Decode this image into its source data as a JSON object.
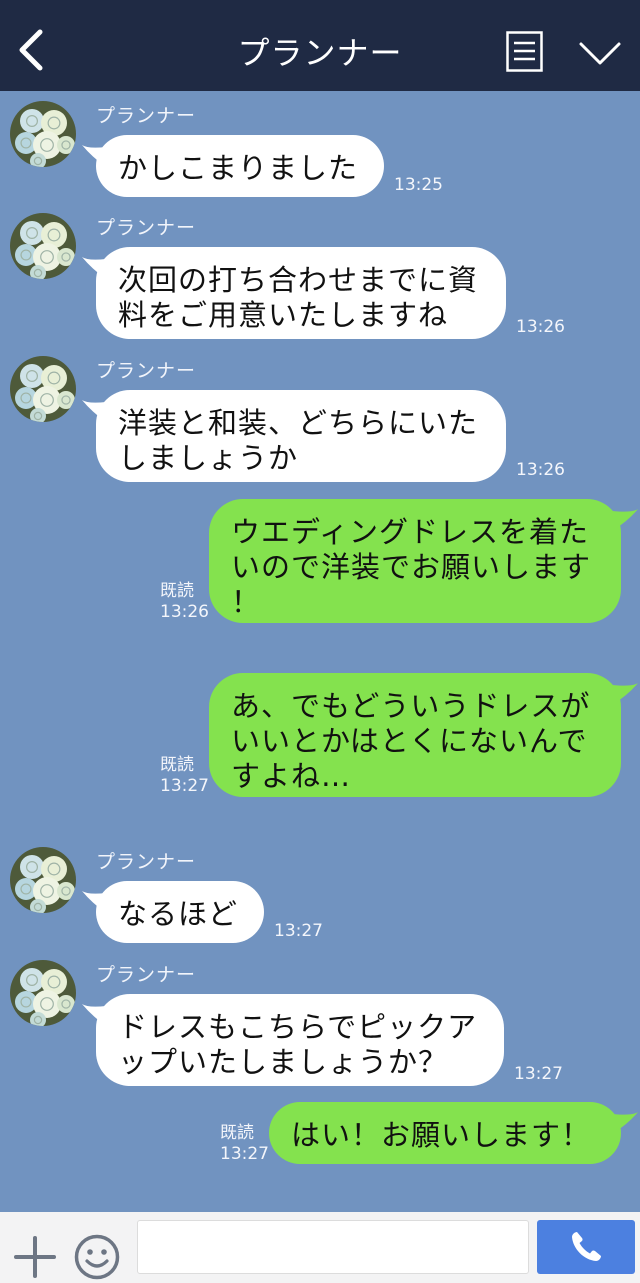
{
  "header": {
    "title": "プランナー",
    "back_icon": "chevron-left-icon",
    "menu_icon": "list-icon",
    "collapse_icon": "chevron-down-icon",
    "background": "#1f2a44"
  },
  "theme": {
    "chat_background": "#7193c0",
    "incoming_bubble": "#ffffff",
    "outgoing_bubble": "#84e24e",
    "send_button": "#4c80e0"
  },
  "messages": [
    {
      "direction": "in",
      "sender": "プランナー",
      "lines": [
        "かしこまりました"
      ],
      "time": "13:25"
    },
    {
      "direction": "in",
      "sender": "プランナー",
      "lines": [
        "次回の打ち合わせまでに資",
        "料をご用意いたしますね"
      ],
      "time": "13:26"
    },
    {
      "direction": "in",
      "sender": "プランナー",
      "lines": [
        "洋装と和装、どちらにいた",
        "しましょうか"
      ],
      "time": "13:26"
    },
    {
      "direction": "out",
      "lines": [
        "ウエディングドレスを着た",
        "いので洋装でお願いします",
        "！"
      ],
      "read": "既読",
      "time": "13:26"
    },
    {
      "direction": "out",
      "lines": [
        "あ、でもどういうドレスが",
        "いいとかはとくにないんで",
        "すよね…"
      ],
      "read": "既読",
      "time": "13:27"
    },
    {
      "direction": "in",
      "sender": "プランナー",
      "lines": [
        "なるほど"
      ],
      "time": "13:27"
    },
    {
      "direction": "in",
      "sender": "プランナー",
      "lines": [
        "ドレスもこちらでピックア",
        "ップいたしましょうか？"
      ],
      "time": "13:27"
    },
    {
      "direction": "out",
      "lines": [
        "はい！お願いします！"
      ],
      "read": "既読",
      "time": "13:27"
    }
  ],
  "footer": {
    "plus_icon": "plus-icon",
    "emoji_icon": "smiley-icon",
    "input_placeholder": "",
    "send_icon": "phone-icon"
  }
}
